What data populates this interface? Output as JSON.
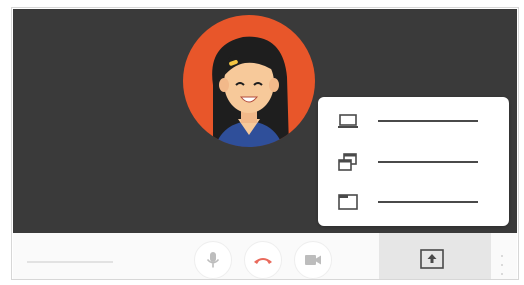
{
  "colors": {
    "stage_background": "#3a3a3a",
    "avatar_background": "#e8562a",
    "hang_up_red": "#e96a5c",
    "present_panel": "#e6e6e6",
    "icon_grey": "#bdbdbd"
  },
  "stage": {
    "avatar": {
      "icon": "user-avatar-illustration"
    }
  },
  "present_menu": {
    "items": [
      {
        "icon": "laptop-icon",
        "label": ""
      },
      {
        "icon": "windows-icon",
        "label": ""
      },
      {
        "icon": "tab-icon",
        "label": ""
      }
    ]
  },
  "toolbar": {
    "meeting_details": "",
    "controls": [
      {
        "icon": "microphone-icon"
      },
      {
        "icon": "hang-up-icon"
      },
      {
        "icon": "camera-icon"
      }
    ],
    "present_now": {
      "icon": "present-screen-icon"
    },
    "more_options": {
      "icon": "more-vertical-icon"
    }
  }
}
